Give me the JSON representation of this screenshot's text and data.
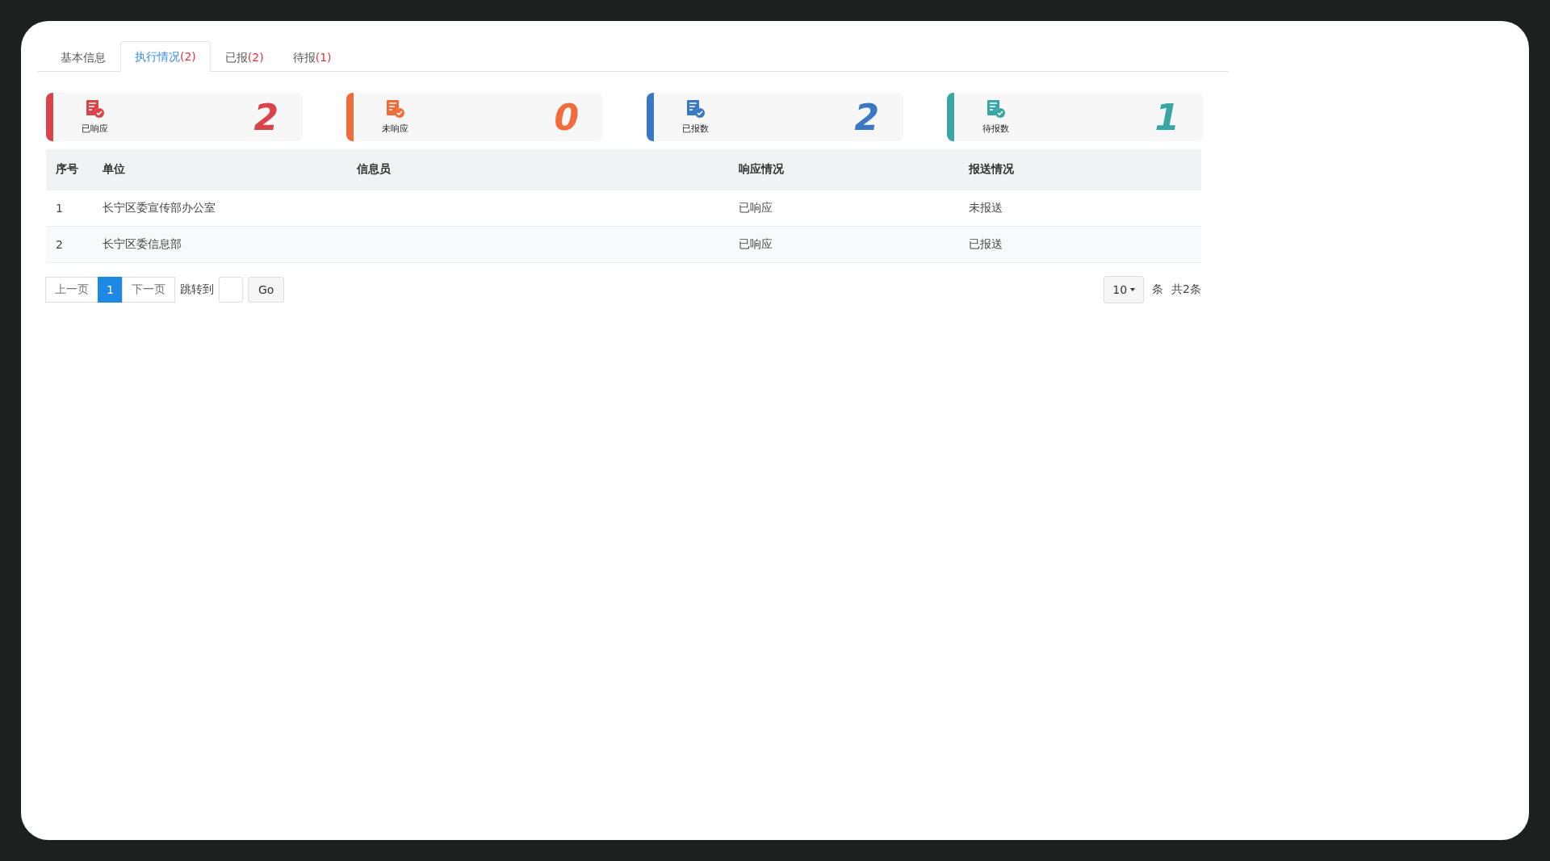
{
  "tabs": [
    {
      "label": "基本信息",
      "selected": false
    },
    {
      "label": "执行情况",
      "count": "(2)",
      "selected": true
    },
    {
      "label": "已报",
      "count": "(2)",
      "selected": false
    },
    {
      "label": "待报",
      "count": "(1)",
      "selected": false
    }
  ],
  "stats": [
    {
      "label": "已响应",
      "value": "2",
      "color": "#d9434a"
    },
    {
      "label": "未响应",
      "value": "0",
      "color": "#f26b3a"
    },
    {
      "label": "已报数",
      "value": "2",
      "color": "#3a78c3"
    },
    {
      "label": "待报数",
      "value": "1",
      "color": "#3aa5a5"
    }
  ],
  "table": {
    "columns": [
      "序号",
      "单位",
      "信息员",
      "响应情况",
      "报送情况"
    ],
    "rows": [
      [
        "1",
        "长宁区委宣传部办公室",
        "",
        "已响应",
        "未报送"
      ],
      [
        "2",
        "长宁区委信息部",
        "",
        "已响应",
        "已报送"
      ]
    ]
  },
  "pagination": {
    "prev": "上一页",
    "pages": [
      {
        "label": "1",
        "selected": true
      }
    ],
    "next": "下一页",
    "jump_label": "跳转到",
    "go": "Go",
    "page_size": "10",
    "unit": "条",
    "total": "共2条"
  }
}
